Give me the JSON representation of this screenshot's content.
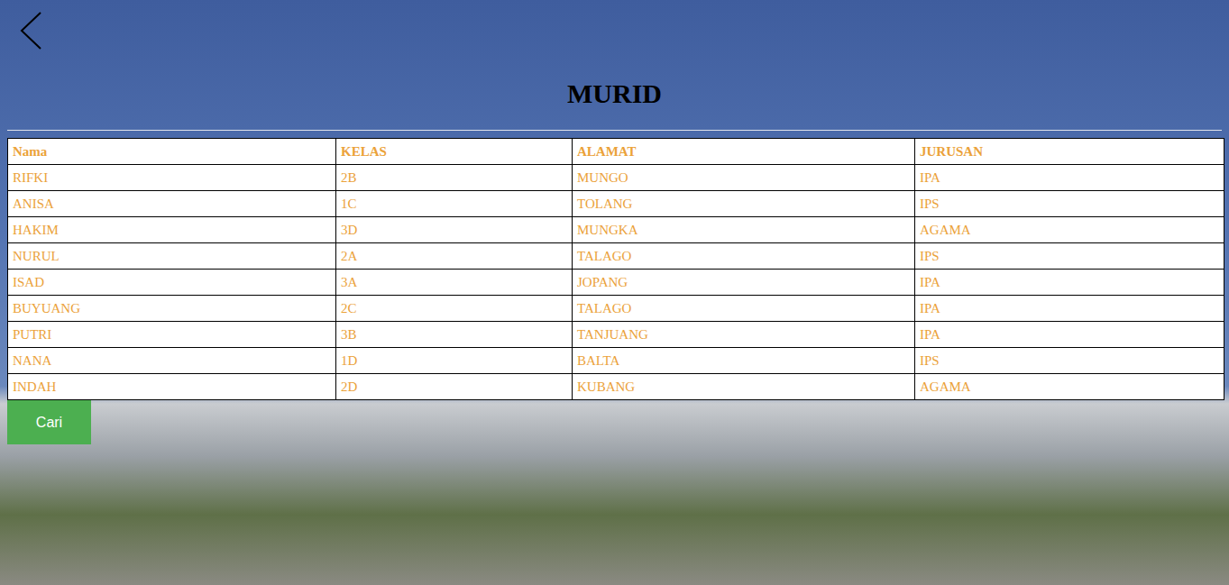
{
  "page": {
    "title": "MURID"
  },
  "table": {
    "columns": [
      "Nama",
      "KELAS",
      "ALAMAT",
      "JURUSAN"
    ],
    "rows": [
      [
        "RIFKI",
        "2B",
        "MUNGO",
        "IPA"
      ],
      [
        "ANISA",
        "1C",
        "TOLANG",
        "IPS"
      ],
      [
        "HAKIM",
        "3D",
        "MUNGKA",
        "AGAMA"
      ],
      [
        "NURUL",
        "2A",
        "TALAGO",
        "IPS"
      ],
      [
        "ISAD",
        "3A",
        "JOPANG",
        "IPA"
      ],
      [
        "BUYUANG",
        "2C",
        "TALAGO",
        "IPA"
      ],
      [
        "PUTRI",
        "3B",
        "TANJUANG",
        "IPA"
      ],
      [
        "NANA",
        "1D",
        "BALTA",
        "IPS"
      ],
      [
        "INDAH",
        "2D",
        "KUBANG",
        "AGAMA"
      ]
    ]
  },
  "buttons": [
    "Cari"
  ]
}
